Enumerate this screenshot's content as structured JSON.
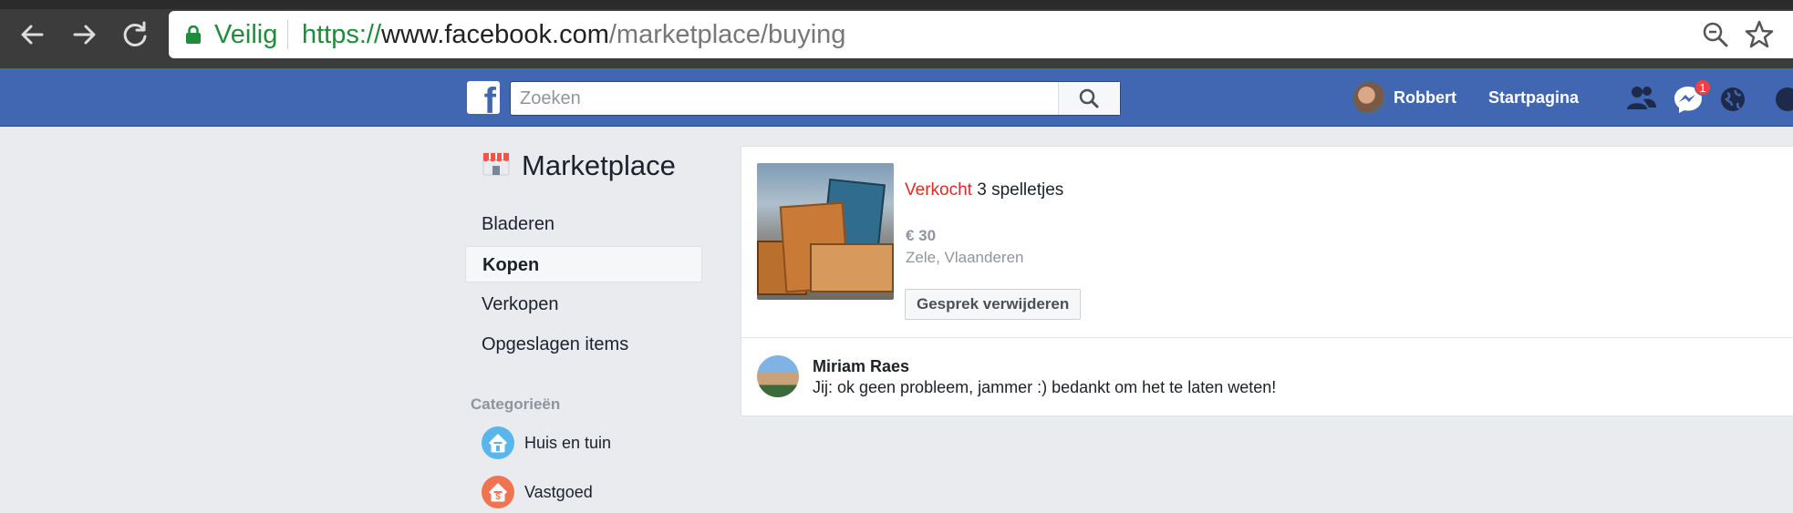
{
  "browser": {
    "security_label": "Veilig",
    "url_scheme": "https://",
    "url_domain": "www.facebook.com",
    "url_path": "/marketplace/buying",
    "icons": [
      "back-icon",
      "forward-icon",
      "reload-icon",
      "lock-icon",
      "zoom-icon",
      "star-icon"
    ]
  },
  "topbar": {
    "search_placeholder": "Zoeken",
    "user_name": "Robbert",
    "home_label": "Startpagina",
    "messages_badge": "1",
    "brand_color": "#4267b2"
  },
  "sidebar": {
    "title": "Marketplace",
    "items": [
      {
        "label": "Bladeren"
      },
      {
        "label": "Kopen"
      },
      {
        "label": "Verkopen"
      },
      {
        "label": "Opgeslagen items"
      }
    ],
    "categories_title": "Categorieën",
    "categories": [
      {
        "label": "Huis en tuin",
        "color": "#58b6ea"
      },
      {
        "label": "Vastgoed",
        "color": "#f07452"
      }
    ]
  },
  "listing": {
    "status": "Verkocht",
    "title": "3 spelletjes",
    "price": "€ 30",
    "location": "Zele, Vlaanderen",
    "delete_button": "Gesprek verwijderen",
    "status_color": "#e02a24"
  },
  "conversation": {
    "name": "Miriam Raes",
    "message": "Jij: ok geen probleem, jammer :) bedankt om het te laten weten!"
  }
}
